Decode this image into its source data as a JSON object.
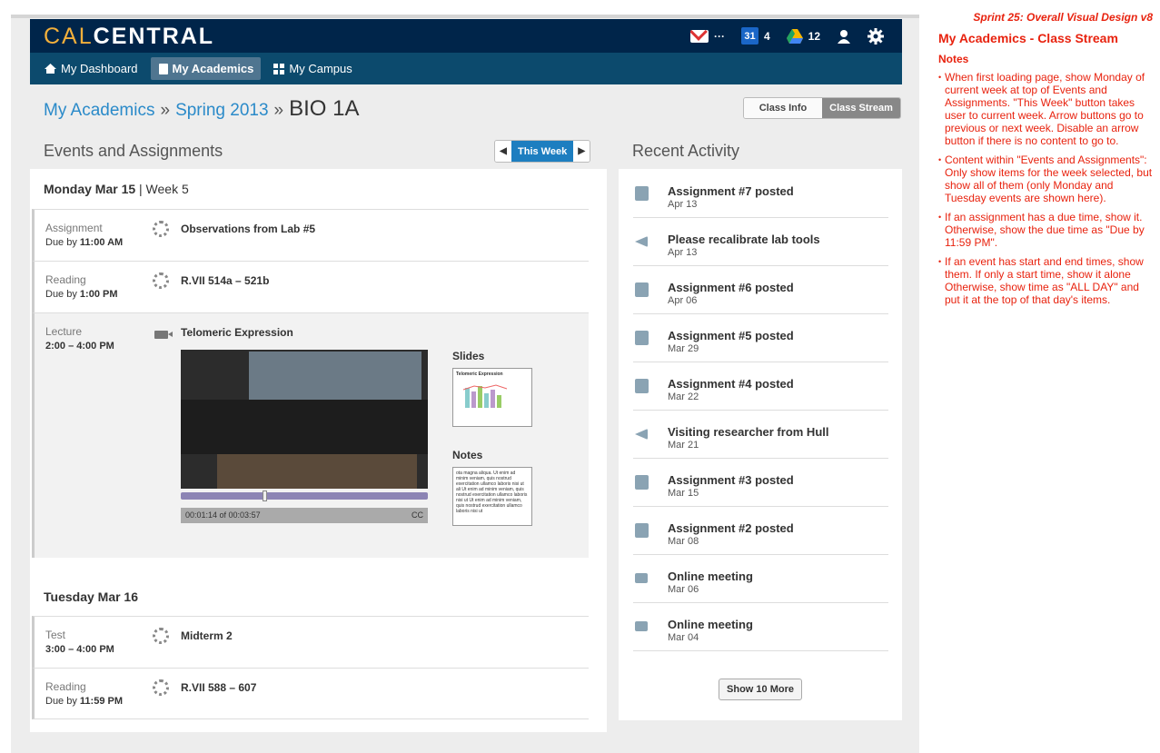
{
  "header": {
    "logo_cal": "CAL",
    "logo_central": "CENTRAL",
    "mail_count": "···",
    "cal_day": "31",
    "cal_count": "4",
    "drive_count": "12"
  },
  "nav": [
    {
      "label": "My Dashboard"
    },
    {
      "label": "My Academics"
    },
    {
      "label": "My Campus"
    }
  ],
  "breadcrumb": {
    "root": "My Academics",
    "term": "Spring 2013",
    "course": "BIO 1A",
    "sep": "»"
  },
  "toggle": {
    "info": "Class Info",
    "stream": "Class Stream"
  },
  "events": {
    "title": "Events and Assignments",
    "this_week": "This Week",
    "day1": {
      "date": "Monday Mar 15",
      "week": "| Week 5"
    },
    "day2": {
      "date": "Tuesday Mar 16"
    },
    "items": [
      {
        "type": "Assignment",
        "prefix": "Due by",
        "time": "11:00 AM",
        "title": "Observations from Lab #5"
      },
      {
        "type": "Reading",
        "prefix": "Due by",
        "time": "1:00 PM",
        "title": "R.VII 514a – 521b"
      },
      {
        "type": "Lecture",
        "prefix": "",
        "time": "2:00 – 4:00 PM",
        "title": "Telomeric Expression"
      },
      {
        "type": "Test",
        "prefix": "",
        "time": "3:00 – 4:00 PM",
        "title": "Midterm 2"
      },
      {
        "type": "Reading",
        "prefix": "Due by",
        "time": "11:59 PM",
        "title": "R.VII 588 – 607"
      }
    ],
    "video": {
      "progress": 0.33,
      "time": "00:01:14 of 00:03:57",
      "cc": "CC"
    },
    "slides_label": "Slides",
    "slide_title": "Telomeric Expression",
    "notes_label": "Notes",
    "notes_text": "ota magna aliqua. Ut enim ad minim veniam, quis nostrud exercitation ullamco laboris nisi ut ali Ut enim ad minim veniam, quis nostrud exercitation ullamco laboris nisi ut Ut enim ad minim veniam, quis nostrud exercitation ullamco laboris nisi ut"
  },
  "recent": {
    "title": "Recent Activity",
    "more": "Show 10 More",
    "items": [
      {
        "icon": "book-icon",
        "title": "Assignment #7 posted",
        "date": "Apr 13"
      },
      {
        "icon": "megaphone-icon",
        "title": "Please recalibrate lab tools",
        "date": "Apr 13"
      },
      {
        "icon": "book-icon",
        "title": "Assignment #6 posted",
        "date": "Apr 06"
      },
      {
        "icon": "book-icon",
        "title": "Assignment #5 posted",
        "date": "Mar 29"
      },
      {
        "icon": "book-icon",
        "title": "Assignment #4 posted",
        "date": "Mar 22"
      },
      {
        "icon": "megaphone-icon",
        "title": "Visiting researcher from Hull",
        "date": "Mar 21"
      },
      {
        "icon": "book-icon",
        "title": "Assignment #3 posted",
        "date": "Mar 15"
      },
      {
        "icon": "book-icon",
        "title": "Assignment #2 posted",
        "date": "Mar 08"
      },
      {
        "icon": "video-icon",
        "title": "Online meeting",
        "date": "Mar 06"
      },
      {
        "icon": "video-icon",
        "title": "Online meeting",
        "date": "Mar 04"
      }
    ]
  },
  "notes": {
    "sprint": "Sprint 25: Overall Visual Design v8",
    "title": "My Academics - Class Stream",
    "heading": "Notes",
    "items": [
      "When first loading page, show Monday of current week at top of Events and Assignments. \"This Week\" button takes user to current week. Arrow buttons go to previous or next week. Disable an arrow button if there is no content to go to.",
      "Content within \"Events and Assignments\": Only show items for the week selected, but show all of them (only Monday and Tuesday events are shown here).",
      "If an assignment has a due time, show it. Otherwise, show the due time as \"Due by 11:59 PM\".",
      "If an event has start and end times, show them. If only a start time, show it alone Otherwise, show time as \"ALL DAY\" and put it at the top of that day's items."
    ]
  }
}
